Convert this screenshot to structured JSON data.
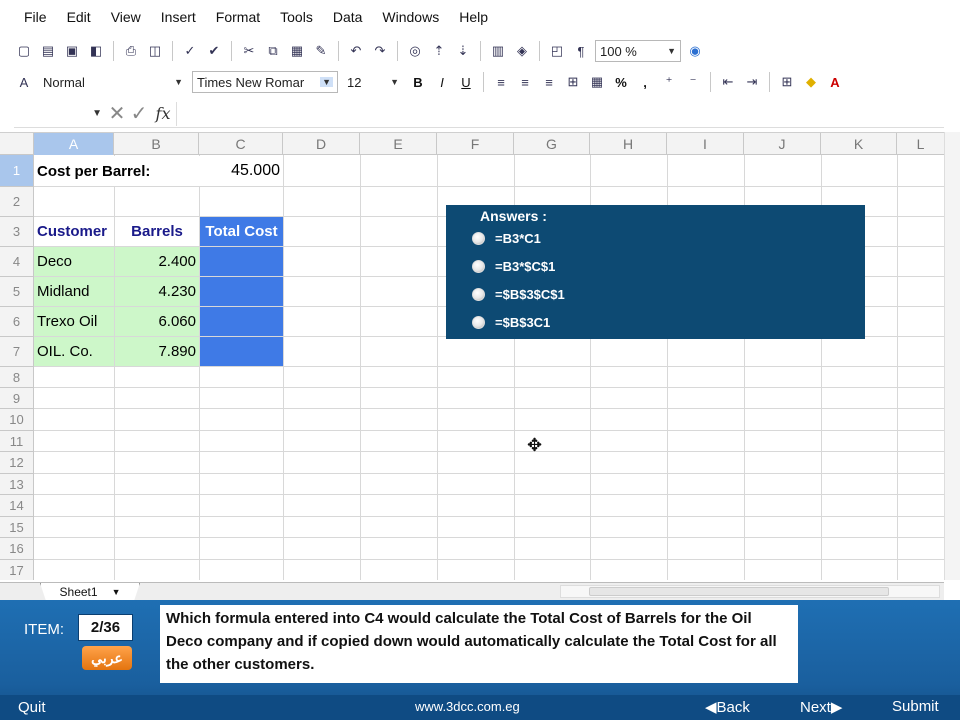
{
  "menu": [
    "File",
    "Edit",
    "View",
    "Insert",
    "Format",
    "Tools",
    "Data",
    "Windows",
    "Help"
  ],
  "toolbar": {
    "zoom": "100 %",
    "style": "Normal",
    "font": "Times New Romar",
    "size": "12",
    "bold": "B",
    "italic": "I",
    "underline": "U",
    "percent": "%",
    "comma": ","
  },
  "formula_bar": {
    "fx": "fx"
  },
  "columns": [
    "A",
    "B",
    "C",
    "D",
    "E",
    "F",
    "G",
    "H",
    "I",
    "J",
    "K",
    "L"
  ],
  "rows": [
    "1",
    "2",
    "3",
    "4",
    "5",
    "6",
    "7",
    "8",
    "9",
    "10",
    "11",
    "12",
    "13",
    "14",
    "15",
    "16",
    "17"
  ],
  "cells": {
    "a1": "Cost per Barrel:",
    "c1": "45.000",
    "a3": "Customer",
    "b3": "Barrels",
    "c3": "Total Cost",
    "a4": "Deco",
    "b4": "2.400",
    "a5": "Midland",
    "b5": "4.230",
    "a6": "Trexo Oil",
    "b6": "6.060",
    "a7": "OIL. Co.",
    "b7": "7.890"
  },
  "answers": {
    "title": "Answers :",
    "options": [
      "=B3*C1",
      "=B3*$C$1",
      "=$B$3$C$1",
      "=$B$3C1"
    ]
  },
  "sheet_tab": "Sheet1",
  "item": {
    "label": "ITEM:",
    "counter": "2/36",
    "arabic": "عربي"
  },
  "question": "Which formula entered into C4 would calculate the  Total Cost of Barrels for the Oil Deco company and if copied down would automatically calculate the Total Cost for all the other customers.",
  "footer": {
    "quit": "Quit",
    "site": "www.3dcc.com.eg",
    "back": "Back",
    "next": "Next",
    "submit": "Submit"
  },
  "colors": {
    "question_panel": "#0d4a73",
    "green_cells": "#cdf7c9",
    "blue_cells": "#3f7ae6",
    "footer": "#0f4b83"
  }
}
